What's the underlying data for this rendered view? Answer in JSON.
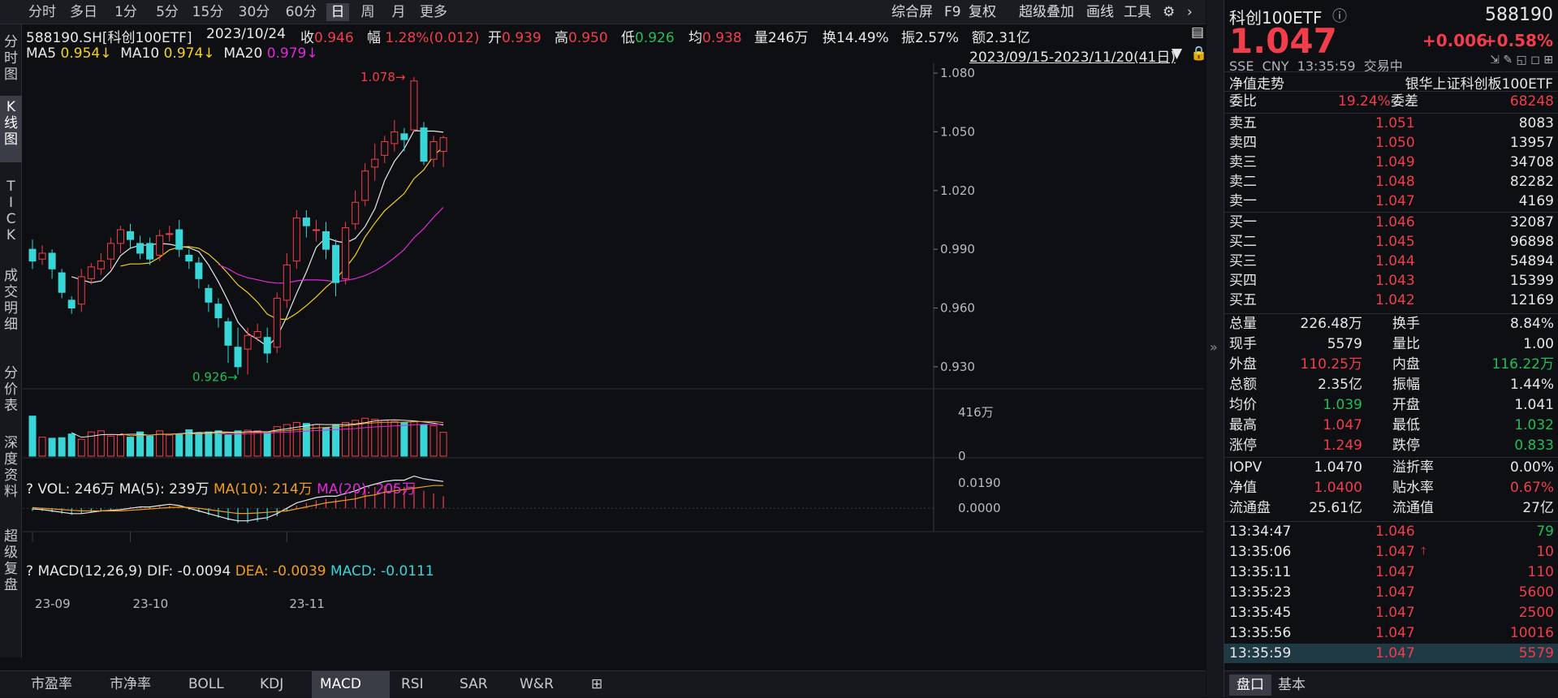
{
  "period_tabs": [
    "分时",
    "多日",
    "1分",
    "5分",
    "15分",
    "30分",
    "60分",
    "日",
    "周",
    "月",
    "更多"
  ],
  "active_period": "日",
  "toolbar": {
    "zhs": "综合屏",
    "f9": "F9",
    "fq": "复权",
    "cjdj": "超级叠加",
    "hx": "画线",
    "gj": "工具"
  },
  "side_tabs": [
    "分\n时\n图",
    "K\n线\n图",
    "T\nI\nC\nK",
    "成\n交\n明\n细",
    "分\n价\n表",
    "深\n度\n资\n料",
    "超\n级\n复\n盘"
  ],
  "header": {
    "code": "588190.SH[科创100ETF]",
    "date": "2023/10/24",
    "close_label": "收",
    "close": "0.946",
    "chg_label": "幅",
    "chg": "1.28%(0.012)",
    "open_label": "开",
    "open": "0.939",
    "high_label": "高",
    "high": "0.950",
    "low_label": "低",
    "low": "0.926",
    "avg_label": "均",
    "avg": "0.938",
    "vol": "量246万",
    "turnover": "换14.49%",
    "amp": "振2.57%",
    "amount": "额2.31亿"
  },
  "ma": {
    "ma5_label": "MA5",
    "ma5": "0.954↓",
    "ma10_label": "MA10",
    "ma10": "0.974↓",
    "ma20_label": "MA20",
    "ma20": "0.979↓"
  },
  "range": "2023/09/15-2023/11/20(41日)",
  "price_axis": [
    "1.080",
    "1.050",
    "1.020",
    "0.990",
    "0.960",
    "0.930"
  ],
  "hi_label": "1.078",
  "lo_label": "0.926",
  "vol_header": {
    "q": "?",
    "vol": "VOL: 246万",
    "ma5": "MA(5): 239万",
    "ma10": "MA(10): 214万",
    "ma20": "MA(20): 205万"
  },
  "vol_axis": [
    "416万",
    "0"
  ],
  "macd_header": {
    "q": "?",
    "name": "MACD(12,26,9)",
    "dif": "DIF: -0.0094",
    "dea": "DEA: -0.0039",
    "macd": "MACD: -0.0111"
  },
  "macd_axis": [
    "0.0190",
    "0.0000"
  ],
  "date_axis": [
    "23-09",
    "23-10",
    "23-11"
  ],
  "bottom_tabs": [
    "市盈率",
    "市净率",
    "BOLL",
    "KDJ",
    "MACD",
    "RSI",
    "SAR",
    "W&R"
  ],
  "active_bottom": "MACD",
  "quote": {
    "name": "科创100ETF",
    "code": "588190",
    "price": "1.047",
    "chg": "+0.006",
    "chg_pct": "+0.58%",
    "exch": "SSE",
    "cur": "CNY",
    "time": "13:35:59",
    "status": "交易中"
  },
  "nav_trend": "净值走势",
  "fund_name": "银华上证科创板100ETF",
  "wb": {
    "label": "委比",
    "val": "19.24%",
    "label2": "委差",
    "val2": "68248"
  },
  "asks": [
    {
      "l": "卖五",
      "p": "1.051",
      "v": "8083"
    },
    {
      "l": "卖四",
      "p": "1.050",
      "v": "13957"
    },
    {
      "l": "卖三",
      "p": "1.049",
      "v": "34708"
    },
    {
      "l": "卖二",
      "p": "1.048",
      "v": "82282"
    },
    {
      "l": "卖一",
      "p": "1.047",
      "v": "4169"
    }
  ],
  "bids": [
    {
      "l": "买一",
      "p": "1.046",
      "v": "32087"
    },
    {
      "l": "买二",
      "p": "1.045",
      "v": "96898"
    },
    {
      "l": "买三",
      "p": "1.044",
      "v": "54894"
    },
    {
      "l": "买四",
      "p": "1.043",
      "v": "15399"
    },
    {
      "l": "买五",
      "p": "1.042",
      "v": "12169"
    }
  ],
  "stats": [
    [
      "总量",
      "226.48万",
      "换手",
      "8.84%"
    ],
    [
      "现手",
      "5579",
      "量比",
      "1.00"
    ],
    [
      "外盘",
      "110.25万",
      "内盘",
      "116.22万"
    ],
    [
      "总额",
      "2.35亿",
      "振幅",
      "1.44%"
    ],
    [
      "均价",
      "1.039",
      "开盘",
      "1.041"
    ],
    [
      "最高",
      "1.047",
      "最低",
      "1.032"
    ],
    [
      "涨停",
      "1.249",
      "跌停",
      "0.833"
    ]
  ],
  "iopv": [
    [
      "IOPV",
      "1.0470",
      "溢折率",
      "0.00%"
    ],
    [
      "净值",
      "1.0400",
      "贴水率",
      "0.67%"
    ],
    [
      "流通盘",
      "25.61亿",
      "流通值",
      "27亿"
    ]
  ],
  "ticks": [
    {
      "t": "13:34:47",
      "p": "1.046",
      "v": "79"
    },
    {
      "t": "13:35:06",
      "p": "1.047",
      "v": "10"
    },
    {
      "t": "13:35:11",
      "p": "1.047",
      "v": "110"
    },
    {
      "t": "13:35:23",
      "p": "1.047",
      "v": "5600"
    },
    {
      "t": "13:35:45",
      "p": "1.047",
      "v": "2500"
    },
    {
      "t": "13:35:56",
      "p": "1.047",
      "v": "10016"
    },
    {
      "t": "13:35:59",
      "p": "1.047",
      "v": "5579"
    }
  ],
  "rp_tabs": [
    "盘口",
    "基本"
  ],
  "chart_data": {
    "type": "candlestick",
    "title": "588190.SH[科创100ETF]",
    "range": "2023/09/15-2023/11/20",
    "ylim": [
      0.92,
      1.085
    ],
    "candles": [
      [
        0.99,
        0.984,
        0.995,
        0.98
      ],
      [
        0.985,
        0.988,
        0.992,
        0.982
      ],
      [
        0.988,
        0.98,
        0.99,
        0.975
      ],
      [
        0.978,
        0.968,
        0.98,
        0.965
      ],
      [
        0.964,
        0.96,
        0.966,
        0.957
      ],
      [
        0.962,
        0.976,
        0.98,
        0.958
      ],
      [
        0.975,
        0.981,
        0.983,
        0.972
      ],
      [
        0.98,
        0.984,
        0.988,
        0.977
      ],
      [
        0.985,
        0.993,
        0.996,
        0.98
      ],
      [
        0.993,
        1.0,
        1.002,
        0.988
      ],
      [
        0.999,
        0.995,
        1.003,
        0.99
      ],
      [
        0.993,
        0.988,
        0.997,
        0.985
      ],
      [
        0.993,
        0.985,
        0.996,
        0.982
      ],
      [
        0.987,
        0.997,
        1.0,
        0.984
      ],
      [
        0.998,
        0.998,
        1.002,
        0.994
      ],
      [
        1.0,
        0.99,
        1.005,
        0.986
      ],
      [
        0.987,
        0.984,
        0.99,
        0.98
      ],
      [
        0.983,
        0.975,
        0.986,
        0.97
      ],
      [
        0.97,
        0.963,
        0.972,
        0.958
      ],
      [
        0.962,
        0.955,
        0.965,
        0.95
      ],
      [
        0.953,
        0.941,
        0.955,
        0.932
      ],
      [
        0.94,
        0.93,
        0.95,
        0.926
      ],
      [
        0.939,
        0.946,
        0.95,
        0.926
      ],
      [
        0.945,
        0.948,
        0.952,
        0.943
      ],
      [
        0.945,
        0.937,
        0.95,
        0.932
      ],
      [
        0.94,
        0.965,
        0.968,
        0.937
      ],
      [
        0.964,
        0.982,
        0.988,
        0.96
      ],
      [
        0.984,
        1.006,
        1.01,
        0.98
      ],
      [
        1.006,
        1.002,
        1.01,
        0.996
      ],
      [
        1.0,
        1.0,
        1.005,
        0.994
      ],
      [
        0.999,
        0.99,
        1.004,
        0.985
      ],
      [
        0.992,
        0.973,
        0.995,
        0.966
      ],
      [
        0.975,
        1.001,
        1.004,
        0.972
      ],
      [
        1.003,
        1.014,
        1.02,
        1.0
      ],
      [
        1.015,
        1.03,
        1.034,
        1.012
      ],
      [
        1.032,
        1.036,
        1.044,
        1.025
      ],
      [
        1.038,
        1.045,
        1.048,
        1.034
      ],
      [
        1.044,
        1.05,
        1.056,
        1.04
      ],
      [
        1.049,
        1.046,
        1.052,
        1.04
      ],
      [
        1.051,
        1.076,
        1.078,
        1.05
      ],
      [
        1.052,
        1.035,
        1.055,
        1.033
      ],
      [
        1.036,
        1.045,
        1.048,
        1.032
      ],
      [
        1.04,
        1.047,
        1.048,
        1.032
      ]
    ],
    "volume": [
      380,
      180,
      170,
      175,
      210,
      160,
      230,
      240,
      190,
      200,
      180,
      230,
      190,
      240,
      200,
      210,
      250,
      220,
      230,
      240,
      200,
      240,
      246,
      240,
      230,
      280,
      300,
      320,
      310,
      300,
      270,
      300,
      320,
      340,
      360,
      350,
      340,
      330,
      320,
      330,
      300,
      290,
      226
    ],
    "vol_ylim": [
      0,
      416
    ],
    "macd": [
      -0.002,
      -0.002,
      -0.003,
      -0.004,
      -0.005,
      -0.004,
      -0.003,
      -0.002,
      -0.001,
      0.0,
      0.001,
      0.001,
      0.001,
      0.002,
      0.002,
      0.001,
      -0.001,
      -0.003,
      -0.005,
      -0.007,
      -0.009,
      -0.011,
      -0.011,
      -0.01,
      -0.009,
      -0.006,
      -0.002,
      0.002,
      0.004,
      0.006,
      0.007,
      0.007,
      0.009,
      0.011,
      0.014,
      0.016,
      0.017,
      0.017,
      0.016,
      0.018,
      0.013,
      0.011,
      0.009
    ],
    "dif": [
      -0.0005,
      -0.001,
      -0.002,
      -0.003,
      -0.004,
      -0.004,
      -0.003,
      -0.002,
      -0.0015,
      -0.001,
      0.0,
      0.001,
      0.001,
      0.002,
      0.003,
      0.002,
      0.0,
      -0.002,
      -0.004,
      -0.006,
      -0.008,
      -0.0094,
      -0.0094,
      -0.008,
      -0.007,
      -0.004,
      0.0,
      0.004,
      0.006,
      0.008,
      0.009,
      0.009,
      0.011,
      0.013,
      0.016,
      0.018,
      0.02,
      0.021,
      0.021,
      0.024,
      0.022,
      0.021,
      0.02
    ],
    "dea": [
      0.0005,
      0.0,
      -0.0005,
      -0.001,
      -0.0015,
      -0.002,
      -0.002,
      -0.002,
      -0.002,
      -0.002,
      -0.0015,
      -0.001,
      -0.0005,
      0.0,
      0.0005,
      0.0008,
      0.0006,
      0.0,
      -0.001,
      -0.002,
      -0.003,
      -0.0039,
      -0.0039,
      -0.0035,
      -0.003,
      -0.0025,
      -0.002,
      -0.0005,
      0.001,
      0.0025,
      0.004,
      0.005,
      0.006,
      0.007,
      0.009,
      0.01,
      0.012,
      0.013,
      0.014,
      0.015,
      0.016,
      0.017,
      0.017
    ],
    "macd_ylim": [
      -0.012,
      0.025
    ]
  }
}
